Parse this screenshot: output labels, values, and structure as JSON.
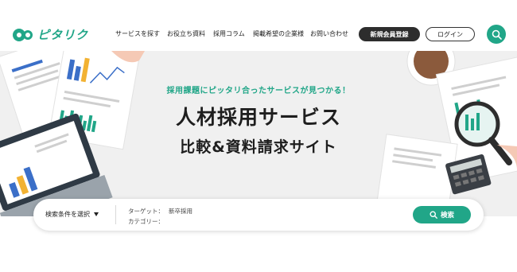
{
  "logo": {
    "text": "ピタリク"
  },
  "nav": {
    "items": [
      {
        "label": "サービスを探す"
      },
      {
        "label": "お役立ち資料"
      },
      {
        "label": "採用コラム"
      },
      {
        "label": "掲載希望の企業様"
      },
      {
        "label": "お問い合わせ"
      }
    ],
    "register_label": "新規会員登録",
    "login_label": "ログイン"
  },
  "hero": {
    "subtitle": "採用課題にピッタリ合ったサービスが見つかる！",
    "title_line1": "人材採用サービス",
    "title_line2": "比較&資料請求サイト"
  },
  "search": {
    "condition_label": "検索条件を選択",
    "conditions": [
      {
        "key": "ターゲット：",
        "value": "新卒採用"
      },
      {
        "key": "カテゴリー：",
        "value": ""
      }
    ],
    "button_label": "検索"
  },
  "colors": {
    "brand": "#21a688",
    "dark_button": "#2d2d2d",
    "hero_background": "#f0f0f0"
  },
  "icons": [
    "logo-mark-icon",
    "search-icon",
    "chevron-down-icon"
  ]
}
